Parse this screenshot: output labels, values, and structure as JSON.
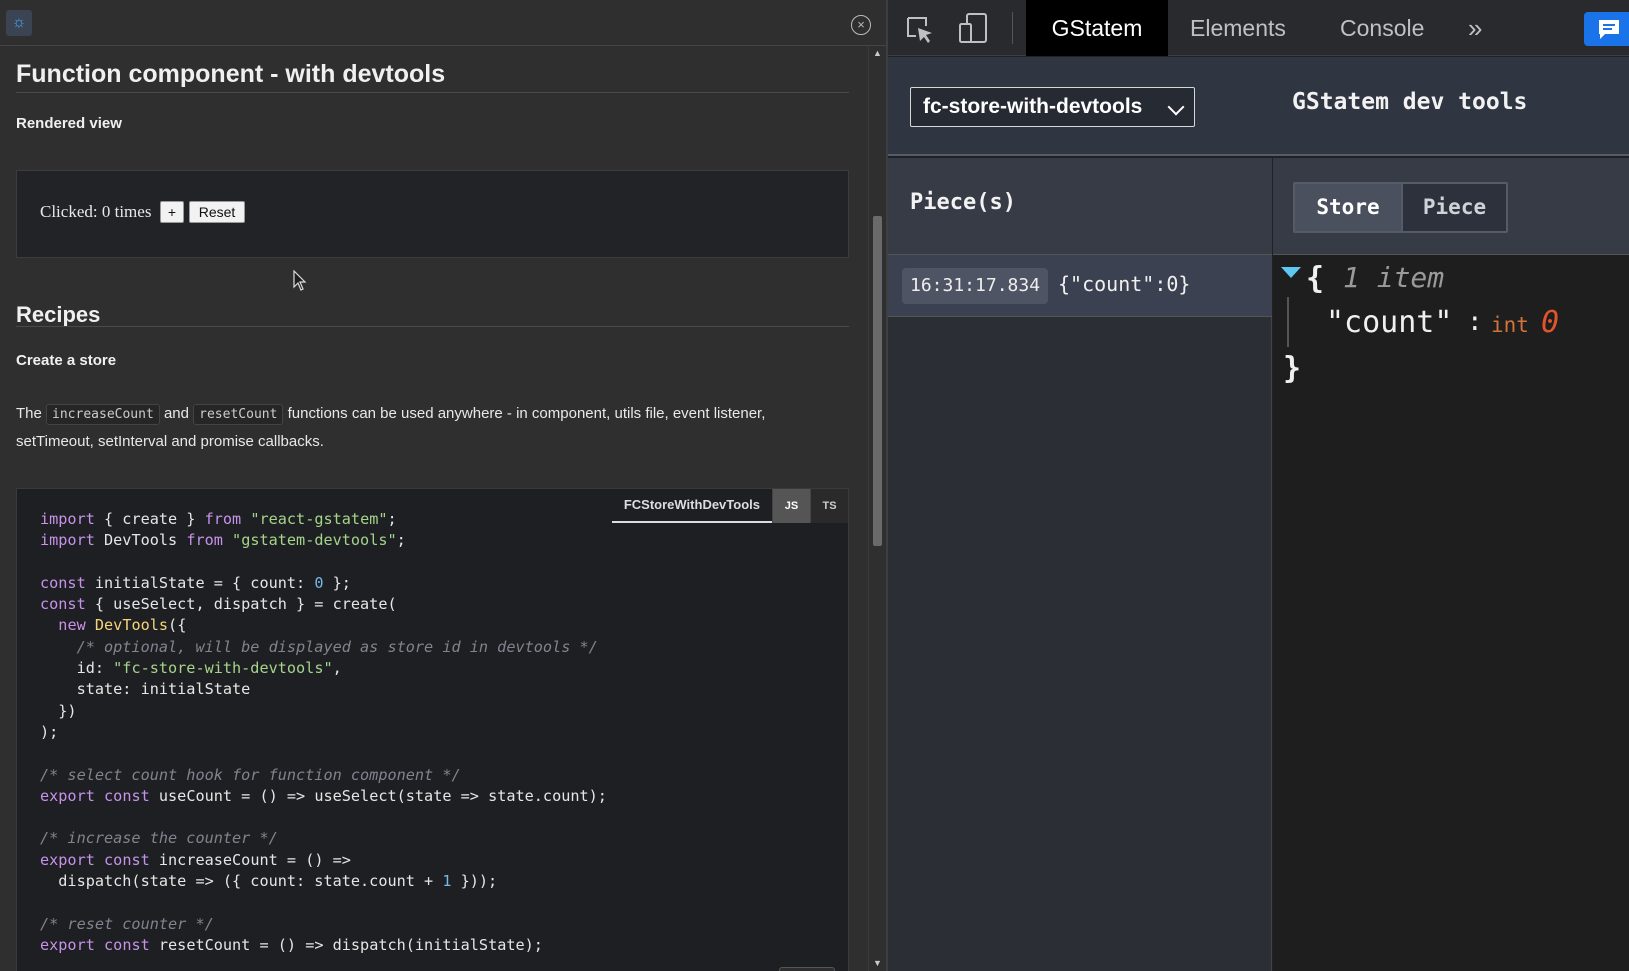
{
  "left": {
    "theme_icon": "sun-icon",
    "close_icon": "close-circle-icon",
    "page_title": "Function component - with devtools",
    "rendered_view_heading": "Rendered view",
    "demo": {
      "clicked_text": "Clicked: 0 times",
      "plus_label": "+",
      "reset_label": "Reset"
    },
    "recipes_heading": "Recipes",
    "create_store_heading": "Create a store",
    "paragraph": {
      "before": "The",
      "code1": "increaseCount",
      "middle": "and",
      "code2": "resetCount",
      "after": "functions can be used anywhere - in component, utils file, event listener, setTimeout, setInterval and promise callbacks."
    },
    "code_block": {
      "file_tab": "FCStoreWithDevTools",
      "lang_js": "JS",
      "lang_ts": "TS",
      "lines": [
        "import { create } from \"react-gstatem\";",
        "import DevTools from \"gstatem-devtools\";",
        "",
        "const initialState = { count: 0 };",
        "const { useSelect, dispatch } = create(",
        "  new DevTools({",
        "    /* optional, will be displayed as store id in devtools */",
        "    id: \"fc-store-with-devtools\",",
        "    state: initialState",
        "  })",
        ");",
        "",
        "/* select count hook for function component */",
        "export const useCount = () => useSelect(state => state.count);",
        "",
        "/* increase the counter */",
        "export const increaseCount = () =>",
        "  dispatch(state => ({ count: state.count + 1 }));",
        "",
        "/* reset counter */",
        "export const resetCount = () => dispatch(initialState);"
      ]
    }
  },
  "devtools": {
    "tabs": [
      {
        "label": "GStatem",
        "active": true
      },
      {
        "label": "Elements",
        "active": false
      },
      {
        "label": "Console",
        "active": false
      }
    ],
    "more_label": "»",
    "icons": {
      "inspect": "inspect-element-icon",
      "device": "device-toolbar-icon",
      "chat": "chat-icon"
    },
    "gstatem": {
      "store_select_value": "fc-store-with-devtools",
      "title": "GStatem dev tools",
      "pieces_title": "Piece(s)",
      "pieces": [
        {
          "time": "16:31:17.834",
          "value": "{\"count\":0}"
        }
      ],
      "view_toggle": {
        "store_label": "Store",
        "piece_label": "Piece",
        "selected": "Store"
      },
      "json": {
        "open_brace": "{",
        "summary": "1 item",
        "key": "\"count\"",
        "colon": ":",
        "type": "int",
        "value": "0",
        "close_brace": "}"
      }
    }
  },
  "colors": {
    "accent_blue": "#1a73e8",
    "caret_cyan": "#5ec8f0",
    "json_number": "#e0552b",
    "json_type": "#d2733a"
  }
}
